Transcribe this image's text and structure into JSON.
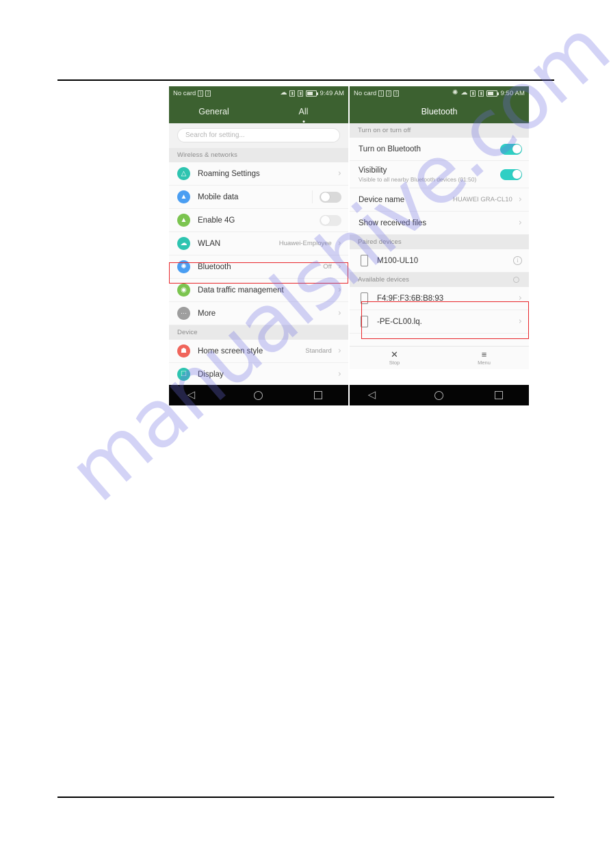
{
  "watermark": {
    "text": "manualshive.com"
  },
  "left_screen": {
    "statusbar": {
      "carrier": "No card",
      "sim_badge": "1",
      "sync_badge": "2",
      "wifi_icon": "wifi-icon",
      "signal1_icon": "signal-bars-icon",
      "signal2_icon": "signal-bars-icon",
      "battery_icon": "battery-icon",
      "time": "9:49 AM"
    },
    "tabs": [
      {
        "label": "General",
        "active": false
      },
      {
        "label": "All",
        "active": true
      }
    ],
    "search": {
      "placeholder": "Search for setting..."
    },
    "sections": [
      {
        "title": "Wireless & networks",
        "rows": [
          {
            "label": "Roaming Settings",
            "value": "",
            "control": "chevron",
            "icon": "roaming-icon",
            "icon_color": "#2ec4b0"
          },
          {
            "label": "Mobile data",
            "value": "",
            "control": "toggle-off",
            "icon": "mobile-data-icon",
            "icon_color": "#4a9ef2"
          },
          {
            "label": "Enable 4G",
            "value": "",
            "control": "toggle-dim",
            "icon": "enable-4g-icon",
            "icon_color": "#7bc44f"
          },
          {
            "label": "WLAN",
            "value": "Huawei-Employee",
            "control": "chevron",
            "icon": "wlan-icon",
            "icon_color": "#2ec4b0"
          },
          {
            "label": "Bluetooth",
            "value": "Off",
            "control": "chevron",
            "icon": "bluetooth-icon",
            "icon_color": "#4a9ef2",
            "highlighted": true
          },
          {
            "label": "Data traffic management",
            "value": "",
            "control": "chevron",
            "icon": "data-traffic-icon",
            "icon_color": "#7bc44f"
          },
          {
            "label": "More",
            "value": "",
            "control": "chevron",
            "icon": "more-icon",
            "icon_color": "#9e9e9e"
          }
        ]
      },
      {
        "title": "Device",
        "rows": [
          {
            "label": "Home screen style",
            "value": "Standard",
            "control": "chevron",
            "icon": "home-screen-icon",
            "icon_color": "#f0655b"
          },
          {
            "label": "Display",
            "value": "",
            "control": "chevron",
            "icon": "display-icon",
            "icon_color": "#2ec4b0",
            "clipped": true
          }
        ]
      }
    ],
    "navbar": {
      "back": "back-icon",
      "home": "home-icon",
      "recent": "recent-apps-icon"
    }
  },
  "right_screen": {
    "statusbar": {
      "carrier": "No card",
      "sim_badge": "1",
      "sync_badge": "2",
      "extra_badge": "3",
      "bluetooth_icon": "bluetooth-icon",
      "wifi_icon": "wifi-icon",
      "signal1_icon": "signal-bars-icon",
      "signal2_icon": "signal-bars-icon",
      "battery_icon": "battery-icon",
      "time": "9:50 AM"
    },
    "title": "Bluetooth",
    "section_toggle": "Turn on or turn off",
    "rows": [
      {
        "label": "Turn on Bluetooth",
        "sub": "",
        "value": "",
        "control": "toggle-on"
      },
      {
        "label": "Visibility",
        "sub": "Visible to all nearby Bluetooth devices (01:50)",
        "value": "",
        "control": "toggle-on"
      },
      {
        "label": "Device name",
        "sub": "",
        "value": "HUAWEI GRA-CL10",
        "control": "chevron"
      },
      {
        "label": "Show received files",
        "sub": "",
        "value": "",
        "control": "chevron"
      }
    ],
    "paired_section": "Paired devices",
    "paired_devices": [
      {
        "name": "M100-UL10",
        "control": "info"
      }
    ],
    "available_section": "Available devices",
    "available_devices": [
      {
        "name": "F4:9F:F3:6B:B8:93",
        "control": "chevron"
      },
      {
        "name": "-PE-CL00.lq.",
        "control": "chevron"
      }
    ],
    "actions": [
      {
        "icon": "close-icon",
        "glyph": "✕",
        "label": "Stop"
      },
      {
        "icon": "menu-icon",
        "glyph": "≡",
        "label": "Menu"
      }
    ],
    "navbar": {
      "back": "back-icon",
      "home": "home-icon",
      "recent": "recent-apps-icon"
    }
  }
}
